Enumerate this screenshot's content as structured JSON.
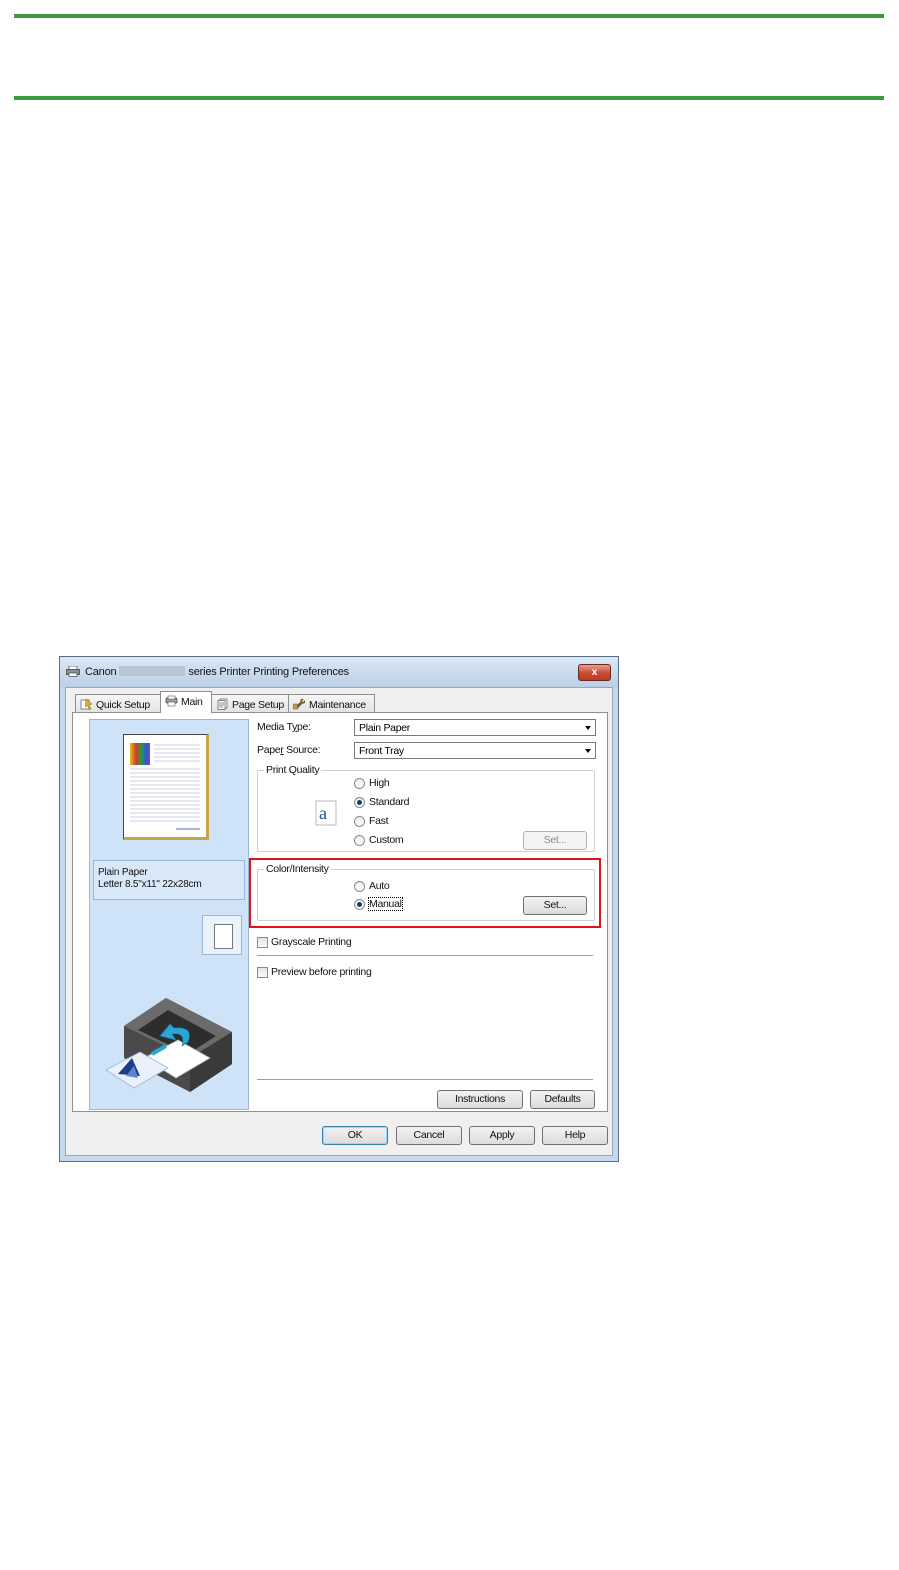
{
  "page": {
    "accent_color": "#3c9a3c"
  },
  "window": {
    "title_prefix": "Canon",
    "title_suffix": "series Printer Printing Preferences",
    "close_label": "x",
    "highlight_color": "#e0121b"
  },
  "tabs": [
    {
      "label": "Quick Setup",
      "icon": "quick-setup-icon",
      "active": false
    },
    {
      "label": "Main",
      "icon": "main-tab-icon",
      "active": true
    },
    {
      "label": "Page Setup",
      "icon": "page-setup-icon",
      "active": false
    },
    {
      "label": "Maintenance",
      "icon": "maintenance-icon",
      "active": false
    }
  ],
  "preview": {
    "paper_line1": "Plain Paper",
    "paper_line2": "Letter 8.5\"x11\" 22x28cm"
  },
  "settings": {
    "media_type_label_pre": "Media T",
    "media_type_label_key": "y",
    "media_type_label_post": "pe:",
    "media_type_value": "Plain Paper",
    "paper_source_label_pre": "Pape",
    "paper_source_label_key": "r",
    "paper_source_label_post": " Source:",
    "paper_source_value": "Front Tray"
  },
  "print_quality": {
    "title": "Print Quality",
    "options": {
      "high": "High",
      "standard": "Standard",
      "fast": "Fast",
      "custom": "Custom"
    },
    "selected": "Standard",
    "set_button": "Set...",
    "icon": "quality-a-icon"
  },
  "color_intensity": {
    "title": "Color/Intensity",
    "options": {
      "auto": "Auto",
      "manual": "Manual"
    },
    "selected": "Manual",
    "set_button": "Set..."
  },
  "checkboxes": {
    "grayscale": "Grayscale Printing",
    "preview": "Preview before printing"
  },
  "buttons": {
    "instructions": "Instructions",
    "defaults": "Defaults",
    "ok": "OK",
    "cancel": "Cancel",
    "apply": "Apply",
    "help": "Help"
  }
}
